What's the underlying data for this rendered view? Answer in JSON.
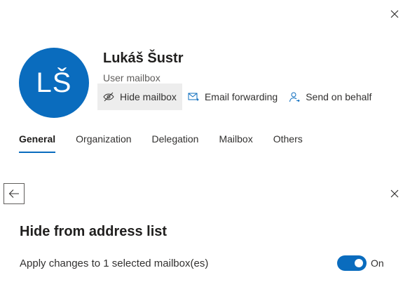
{
  "user": {
    "initials": "LŠ",
    "name": "Lukáš Šustr",
    "type": "User mailbox",
    "avatar_color": "#0a6cbe"
  },
  "actions": [
    {
      "label": "Hide mailbox",
      "icon": "hide-mailbox-icon",
      "active": true
    },
    {
      "label": "Email forwarding",
      "icon": "mail-forward-icon",
      "active": false
    },
    {
      "label": "Send on behalf",
      "icon": "person-icon",
      "active": false
    }
  ],
  "tabs": [
    {
      "label": "General",
      "selected": true
    },
    {
      "label": "Organization",
      "selected": false
    },
    {
      "label": "Delegation",
      "selected": false
    },
    {
      "label": "Mailbox",
      "selected": false
    },
    {
      "label": "Others",
      "selected": false
    }
  ],
  "subpanel": {
    "title": "Hide from address list",
    "apply_text": "Apply changes to 1 selected mailbox(es)",
    "toggle_state": "On",
    "toggle_on": true
  },
  "colors": {
    "accent": "#0a6cbe",
    "active_action_bg": "#ededed"
  }
}
